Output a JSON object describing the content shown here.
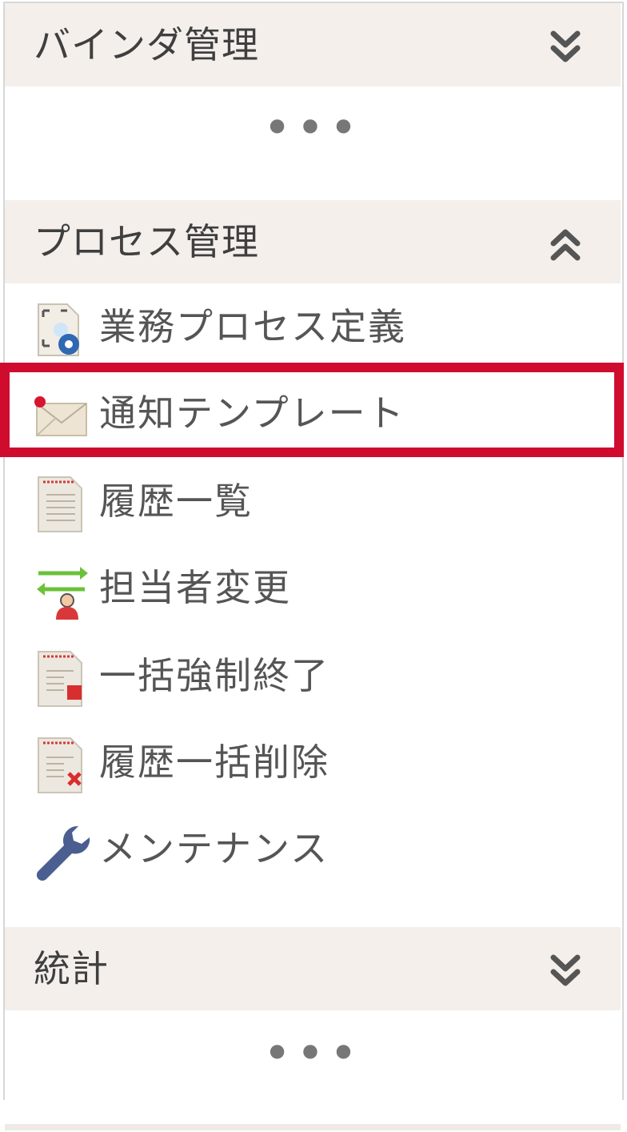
{
  "sections": [
    {
      "title": "バインダ管理",
      "state": "collapsed",
      "collapsed_indicator": "•••"
    },
    {
      "title": "プロセス管理",
      "state": "expanded",
      "items": [
        {
          "label": "業務プロセス定義",
          "icon": "process-definition-icon"
        },
        {
          "label": "通知テンプレート",
          "icon": "mail-icon",
          "highlighted": true
        },
        {
          "label": "履歴一覧",
          "icon": "history-document-icon"
        },
        {
          "label": "担当者変更",
          "icon": "assignee-swap-icon"
        },
        {
          "label": "一括強制終了",
          "icon": "bulk-terminate-icon"
        },
        {
          "label": "履歴一括削除",
          "icon": "bulk-delete-history-icon"
        },
        {
          "label": "メンテナンス",
          "icon": "wrench-icon"
        }
      ]
    },
    {
      "title": "統計",
      "state": "collapsed",
      "collapsed_indicator": "•••"
    }
  ],
  "colors": {
    "header_bg": "#f4efeb",
    "highlight": "#cf0c2e",
    "text": "#555555",
    "wrench": "#4a5f8f"
  }
}
